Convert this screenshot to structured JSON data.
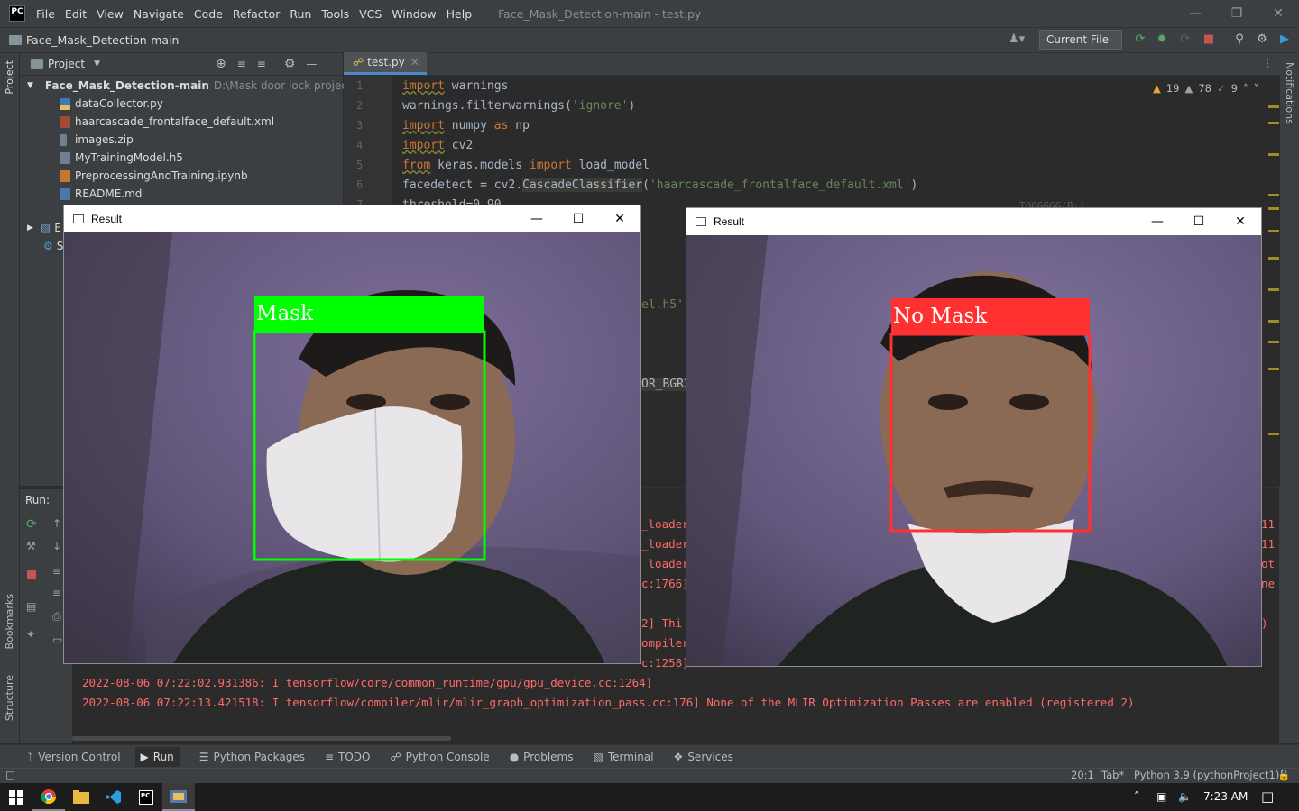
{
  "app": {
    "logo_text": "PC",
    "menu": [
      "File",
      "Edit",
      "View",
      "Navigate",
      "Code",
      "Refactor",
      "Run",
      "Tools",
      "VCS",
      "Window",
      "Help"
    ],
    "window_title": "Face_Mask_Detection-main - test.py",
    "nav_title": "Face_Mask_Detection-main",
    "run_config": "Current File"
  },
  "left_strip": {
    "project": "Project",
    "bookmarks": "Bookmarks",
    "structure": "Structure"
  },
  "right_strip": {
    "notifications": "Notifications"
  },
  "project_panel": {
    "header": "Project",
    "root": {
      "name": "Face_Mask_Detection-main",
      "path": "D:\\Mask door lock project\\Fac"
    },
    "files": [
      {
        "name": "dataCollector.py",
        "icon": "python-file-icon"
      },
      {
        "name": "haarcascade_frontalface_default.xml",
        "icon": "xml-file-icon"
      },
      {
        "name": "images.zip",
        "icon": "archive-file-icon"
      },
      {
        "name": "MyTrainingModel.h5",
        "icon": "h5-file-icon"
      },
      {
        "name": "PreprocessingAndTraining.ipynb",
        "icon": "notebook-file-icon"
      },
      {
        "name": "README.md",
        "icon": "markdown-file-icon"
      }
    ],
    "ext_libs": "E",
    "scratches": "S"
  },
  "editor": {
    "tab": "test.py",
    "line_numbers": [
      "1",
      "2",
      "3",
      "4",
      "5",
      "6",
      "7"
    ],
    "lines": {
      "l1_kw": "import",
      "l1_rest": " warnings",
      "l2": "warnings.filterwarnings(",
      "l2_str": "'ignore'",
      "l2_end": ")",
      "l3_kw": "import",
      "l3_mid": " numpy ",
      "l3_as": "as",
      "l3_end": " np",
      "l4_kw": "import",
      "l4_rest": " cv2",
      "l5_kw": "from",
      "l5_mid": " keras.models ",
      "l5_imp": "import",
      "l5_end": " load_model",
      "l6_a": "facedetect = cv2.",
      "l6_cls": "CascadeClassifier",
      "l6_b": "(",
      "l6_str": "'haarcascade_frontalface_default.xml'",
      "l6_c": ")",
      "l7": "threshold=0.90"
    },
    "peek": {
      "model": "el.h5')",
      "bgr": "OR_BGR2",
      "partial_right": "TOGGGGG(B·)"
    },
    "inspections": {
      "warnings": "19",
      "weak": "78",
      "ok": "9"
    }
  },
  "run_panel": {
    "label": "Run:",
    "peek_lines": [
      "_loader",
      "_loader",
      "_loader",
      "c:1766]",
      "2] Thi",
      "ompiler",
      "c:1258]"
    ],
    "right_peek": [
      "11",
      "11",
      "ot",
      "ne",
      ")"
    ],
    "console": [
      "2022-08-06 07:22:02.931386: I tensorflow/core/common_runtime/gpu/gpu_device.cc:1264]",
      "2022-08-06 07:22:13.421518: I tensorflow/compiler/mlir/mlir_graph_optimization_pass.cc:176] None of the MLIR Optimization Passes are enabled (registered 2)"
    ]
  },
  "bottom_tabs": [
    "Version Control",
    "Run",
    "Python Packages",
    "TODO",
    "Python Console",
    "Problems",
    "Terminal",
    "Services"
  ],
  "status_bar": {
    "position": "20:1",
    "indent": "Tab*",
    "interpreter": "Python 3.9 (pythonProject1)"
  },
  "taskbar": {
    "time": "7:23 AM"
  },
  "result_windows": [
    {
      "title": "Result",
      "label": "Mask",
      "color": "#00ff00"
    },
    {
      "title": "Result",
      "label": "No Mask",
      "color": "#ff3030"
    }
  ]
}
